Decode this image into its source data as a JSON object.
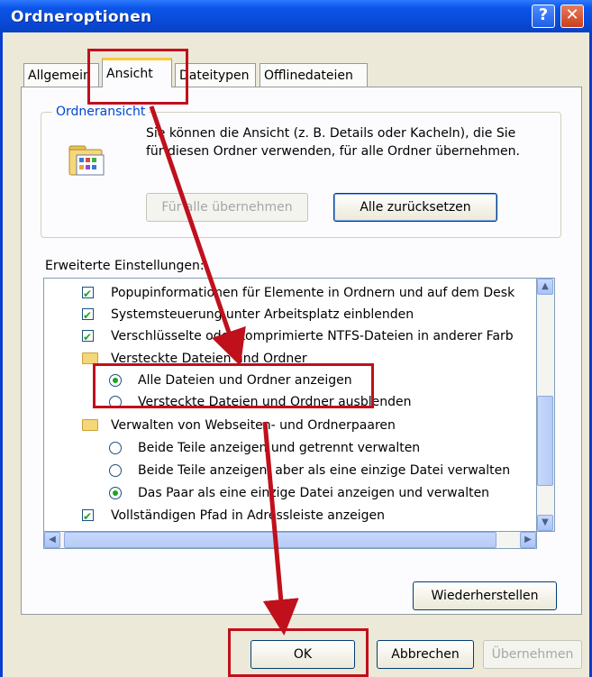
{
  "window": {
    "title": "Ordneroptionen",
    "help_glyph": "?",
    "close_glyph": "✕"
  },
  "tabs": [
    {
      "label": "Allgemein"
    },
    {
      "label": "Ansicht"
    },
    {
      "label": "Dateitypen"
    },
    {
      "label": "Offlinedateien"
    }
  ],
  "folder_view": {
    "title": "Ordneransicht",
    "description": "Sie können die Ansicht (z. B. Details oder Kacheln), die Sie für diesen Ordner verwenden, für alle Ordner übernehmen.",
    "apply_all_label": "Für alle übernehmen",
    "reset_all_label": "Alle zurücksetzen"
  },
  "advanced": {
    "label": "Erweiterte Einstellungen:",
    "items": [
      {
        "kind": "checkbox",
        "checked": true,
        "label": "Popupinformationen für Elemente in Ordnern und auf dem Desk"
      },
      {
        "kind": "checkbox",
        "checked": true,
        "label": "Systemsteuerung unter Arbeitsplatz einblenden"
      },
      {
        "kind": "checkbox",
        "checked": true,
        "label": "Verschlüsselte oder komprimierte NTFS-Dateien in anderer Farb"
      },
      {
        "kind": "folder",
        "label": "Versteckte Dateien und Ordner"
      },
      {
        "kind": "radio",
        "checked": true,
        "label": "Alle Dateien und Ordner anzeigen"
      },
      {
        "kind": "radio",
        "checked": false,
        "label": "Versteckte Dateien und Ordner ausblenden"
      },
      {
        "kind": "folder",
        "label": "Verwalten von Webseiten- und Ordnerpaaren"
      },
      {
        "kind": "radio",
        "checked": false,
        "label": "Beide Teile anzeigen und getrennt verwalten"
      },
      {
        "kind": "radio",
        "checked": false,
        "label": "Beide Teile anzeigen, aber als eine einzige Datei verwalten"
      },
      {
        "kind": "radio",
        "checked": true,
        "label": "Das Paar als eine einzige Datei anzeigen und verwalten"
      },
      {
        "kind": "checkbox",
        "checked": true,
        "label": "Vollständigen Pfad in Adressleiste anzeigen"
      }
    ],
    "scroll_up_glyph": "▲",
    "scroll_down_glyph": "▼",
    "scroll_left_glyph": "◀",
    "scroll_right_glyph": "▶"
  },
  "restore_label": "Wiederherstellen",
  "footer": {
    "ok_label": "OK",
    "cancel_label": "Abbrechen",
    "apply_label": "Übernehmen"
  },
  "colors": {
    "titlebar": "#0a49d6",
    "highlight": "#c0101c",
    "check": "#21a121"
  },
  "icons": {
    "folder_view": "folder-view-icon",
    "item_folder": "folder-icon"
  }
}
